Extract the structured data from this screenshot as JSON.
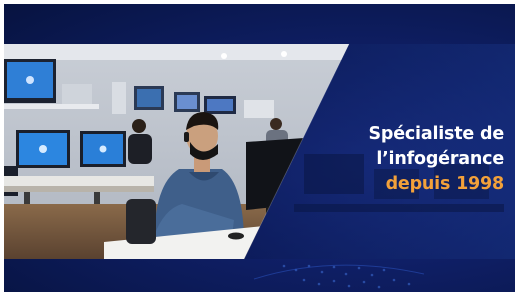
{
  "headline": {
    "line1": "Spécialiste de",
    "line2": "l’infogérance",
    "line3": "depuis 1998"
  },
  "colors": {
    "background_dark": "#071340",
    "background_mid": "#1b2f8a",
    "accent": "#f3a13a",
    "text": "#ffffff"
  },
  "photo": {
    "subject": "person-wearing-face-mask-with-headset-at-computer-workstation",
    "setting": "office-with-rows-of-desktop-computers"
  }
}
